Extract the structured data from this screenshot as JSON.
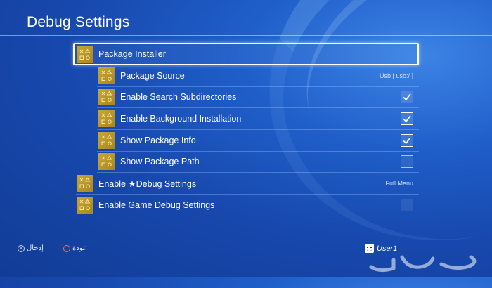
{
  "page": {
    "title": "Debug Settings"
  },
  "items": [
    {
      "label": "Package Installer",
      "control": "none",
      "selected": true,
      "indent": 0
    },
    {
      "label": "Package Source",
      "control": "value",
      "value": "Usb [ usb:/ ]",
      "indent": 1
    },
    {
      "label": "Enable Search Subdirectories",
      "control": "checkbox",
      "checked": true,
      "indent": 1
    },
    {
      "label": "Enable Background Installation",
      "control": "checkbox",
      "checked": true,
      "indent": 1
    },
    {
      "label": "Show Package Info",
      "control": "checkbox",
      "checked": true,
      "indent": 1
    },
    {
      "label": "Show Package Path",
      "control": "checkbox",
      "checked": false,
      "indent": 1
    },
    {
      "label": "Enable ★Debug Settings",
      "control": "value",
      "value": "Full Menu",
      "indent": 0
    },
    {
      "label": "Enable Game Debug Settings",
      "control": "checkbox",
      "checked": false,
      "indent": 0
    }
  ],
  "footer": {
    "enter_label": "إدخال",
    "back_label": "عودة",
    "user_name": "User1"
  },
  "watermark": "حراج",
  "colors": {
    "background": "#1a4fb5",
    "icon_gold": "#c9a633",
    "accent_white": "#ffffff"
  }
}
